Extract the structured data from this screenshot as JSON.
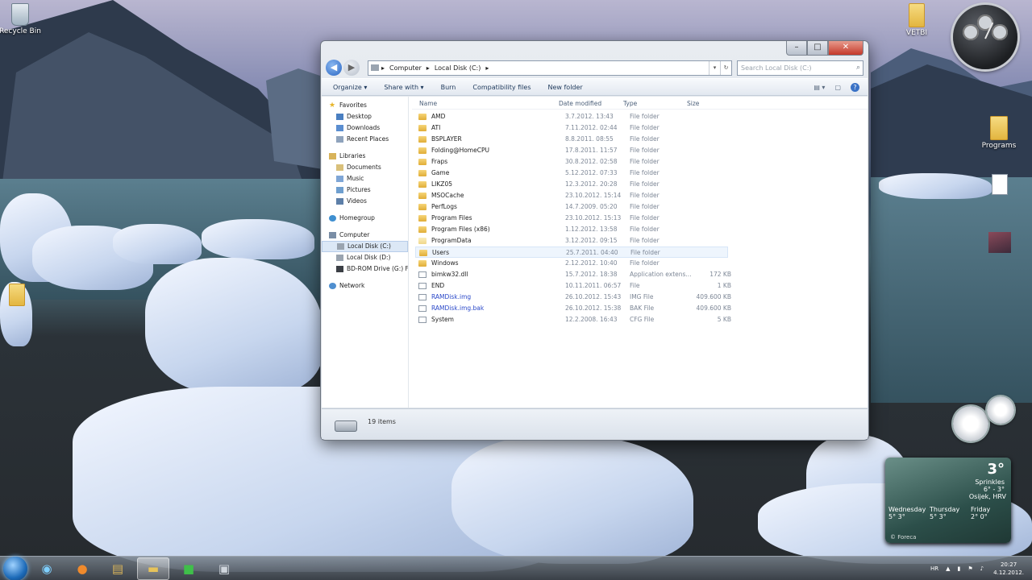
{
  "desktop": {
    "icons": [
      {
        "id": "recycle-bin",
        "label": "Recycle Bin"
      },
      {
        "id": "vetbi",
        "label": "VETBI"
      },
      {
        "id": "programs",
        "label": "Programs"
      }
    ]
  },
  "window": {
    "address": {
      "segments": [
        "Computer",
        "Local Disk (C:)"
      ],
      "separator": "▸"
    },
    "search_placeholder": "Search Local Disk (C:)",
    "caption": {
      "minimize": "–",
      "maximize": "□",
      "close": "✕"
    },
    "toolbar": {
      "organize": "Organize ▾",
      "share_with": "Share with ▾",
      "burn": "Burn",
      "compatibility": "Compatibility files",
      "new_folder": "New folder",
      "views": "▤ ▾",
      "preview": "▢",
      "help": "?"
    },
    "nav": {
      "favorites": "Favorites",
      "favorites_items": [
        "Desktop",
        "Downloads",
        "Recent Places"
      ],
      "libraries": "Libraries",
      "libraries_items": [
        "Documents",
        "Music",
        "Pictures",
        "Videos"
      ],
      "homegroup": "Homegroup",
      "computer": "Computer",
      "computer_items": [
        "Local Disk (C:)",
        "Local Disk (D:)",
        "BD-ROM Drive (G:) F"
      ],
      "network": "Network"
    },
    "columns": {
      "name": "Name",
      "date": "Date modified",
      "type": "Type",
      "size": "Size"
    },
    "files": [
      {
        "name": "AMD",
        "date": "3.7.2012. 13:43",
        "type": "File folder",
        "size": "",
        "kind": "folder"
      },
      {
        "name": "ATI",
        "date": "7.11.2012. 02:44",
        "type": "File folder",
        "size": "",
        "kind": "folder"
      },
      {
        "name": "BSPLAYER",
        "date": "8.8.2011. 08:55",
        "type": "File folder",
        "size": "",
        "kind": "folder"
      },
      {
        "name": "Folding@HomeCPU",
        "date": "17.8.2011. 11:57",
        "type": "File folder",
        "size": "",
        "kind": "folder"
      },
      {
        "name": "Fraps",
        "date": "30.8.2012. 02:58",
        "type": "File folder",
        "size": "",
        "kind": "folder"
      },
      {
        "name": "Game",
        "date": "5.12.2012. 07:33",
        "type": "File folder",
        "size": "",
        "kind": "folder"
      },
      {
        "name": "LIKZ05",
        "date": "12.3.2012. 20:28",
        "type": "File folder",
        "size": "",
        "kind": "folder"
      },
      {
        "name": "MSOCache",
        "date": "23.10.2012. 15:14",
        "type": "File folder",
        "size": "",
        "kind": "folder"
      },
      {
        "name": "PerfLogs",
        "date": "14.7.2009. 05:20",
        "type": "File folder",
        "size": "",
        "kind": "folder"
      },
      {
        "name": "Program Files",
        "date": "23.10.2012. 15:13",
        "type": "File folder",
        "size": "",
        "kind": "folder"
      },
      {
        "name": "Program Files (x86)",
        "date": "1.12.2012. 13:58",
        "type": "File folder",
        "size": "",
        "kind": "folder"
      },
      {
        "name": "ProgramData",
        "date": "3.12.2012. 09:15",
        "type": "File folder",
        "size": "",
        "kind": "folder-light"
      },
      {
        "name": "Users",
        "date": "25.7.2011. 04:40",
        "type": "File folder",
        "size": "",
        "kind": "folder"
      },
      {
        "name": "Windows",
        "date": "2.12.2012. 10:40",
        "type": "File folder",
        "size": "",
        "kind": "folder"
      },
      {
        "name": "bimkw32.dll",
        "date": "15.7.2012. 18:38",
        "type": "Application extens...",
        "size": "172 KB",
        "kind": "file"
      },
      {
        "name": "END",
        "date": "10.11.2011. 06:57",
        "type": "File",
        "size": "1 KB",
        "kind": "file"
      },
      {
        "name": "RAMDisk.img",
        "date": "26.10.2012. 15:43",
        "type": "IMG File",
        "size": "409.600 KB",
        "kind": "file-blue"
      },
      {
        "name": "RAMDisk.img.bak",
        "date": "26.10.2012. 15:38",
        "type": "BAK File",
        "size": "409.600 KB",
        "kind": "file-blue"
      },
      {
        "name": "System",
        "date": "12.2.2008. 16:43",
        "type": "CFG File",
        "size": "5 KB",
        "kind": "file"
      }
    ],
    "status": {
      "item_count": "19 items"
    }
  },
  "gadgets": {
    "weather": {
      "temp": "3°",
      "condition": "Sprinkles",
      "range": "6° - 3°",
      "location": "Osijek, HRV",
      "forecast": [
        {
          "day": "Wednesday",
          "temp": "5° 3°"
        },
        {
          "day": "Thursday",
          "temp": "5° 3°"
        },
        {
          "day": "Friday",
          "temp": "2° 0°"
        }
      ],
      "source": "© Foreca"
    }
  },
  "taskbar": {
    "tray": {
      "lang": "HR",
      "time": "20:27",
      "date": "4.12.2012."
    }
  }
}
